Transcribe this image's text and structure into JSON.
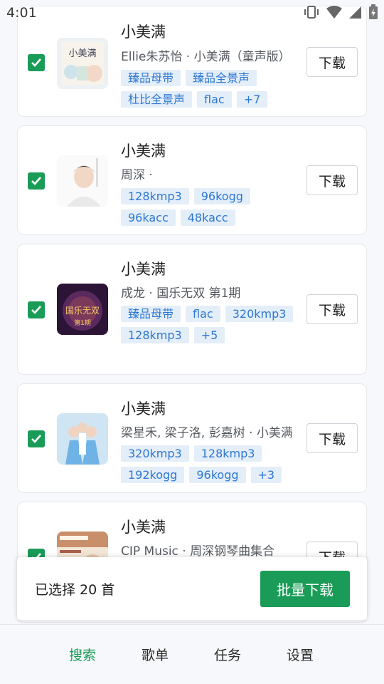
{
  "status_bar": {
    "time": "4:01"
  },
  "songs": [
    {
      "title": "小美满",
      "artist": "Ellie朱苏怡 · 小美满（童声版）",
      "tags": [
        "臻品母带",
        "臻品全景声",
        "杜比全景声",
        "flac",
        "+7"
      ],
      "download_label": "下载",
      "checked": true,
      "cover_text": "小美满"
    },
    {
      "title": "小美满",
      "artist": "周深 ·",
      "tags": [
        "128kmp3",
        "96kogg",
        "96kacc",
        "48kacc"
      ],
      "download_label": "下载",
      "checked": true
    },
    {
      "title": "小美满",
      "artist": "成龙 · 国乐无双 第1期",
      "tags": [
        "臻品母带",
        "flac",
        "320kmp3",
        "128kmp3",
        "+5"
      ],
      "download_label": "下载",
      "checked": true,
      "cover_text": "国乐无双",
      "cover_subtext": "第1期"
    },
    {
      "title": "小美满",
      "artist": "梁星禾, 梁子洛, 彭嘉树 · 小美满",
      "tags": [
        "320kmp3",
        "128kmp3",
        "192kogg",
        "96kogg",
        "+3"
      ],
      "download_label": "下载",
      "checked": true
    },
    {
      "title": "小美满",
      "artist": "CIP Music · 周深钢琴曲集合",
      "tags": [],
      "download_label": "下载",
      "checked": true
    }
  ],
  "bulk_bar": {
    "selected_text": "已选择 20 首",
    "bulk_download_label": "批量下载"
  },
  "bottom_nav": [
    {
      "label": "搜索",
      "active": true
    },
    {
      "label": "歌单",
      "active": false
    },
    {
      "label": "任务",
      "active": false
    },
    {
      "label": "设置",
      "active": false
    }
  ],
  "colors": {
    "accent": "#1a9c58",
    "tag_bg": "#e4eef9",
    "tag_text": "#2d77d2"
  }
}
